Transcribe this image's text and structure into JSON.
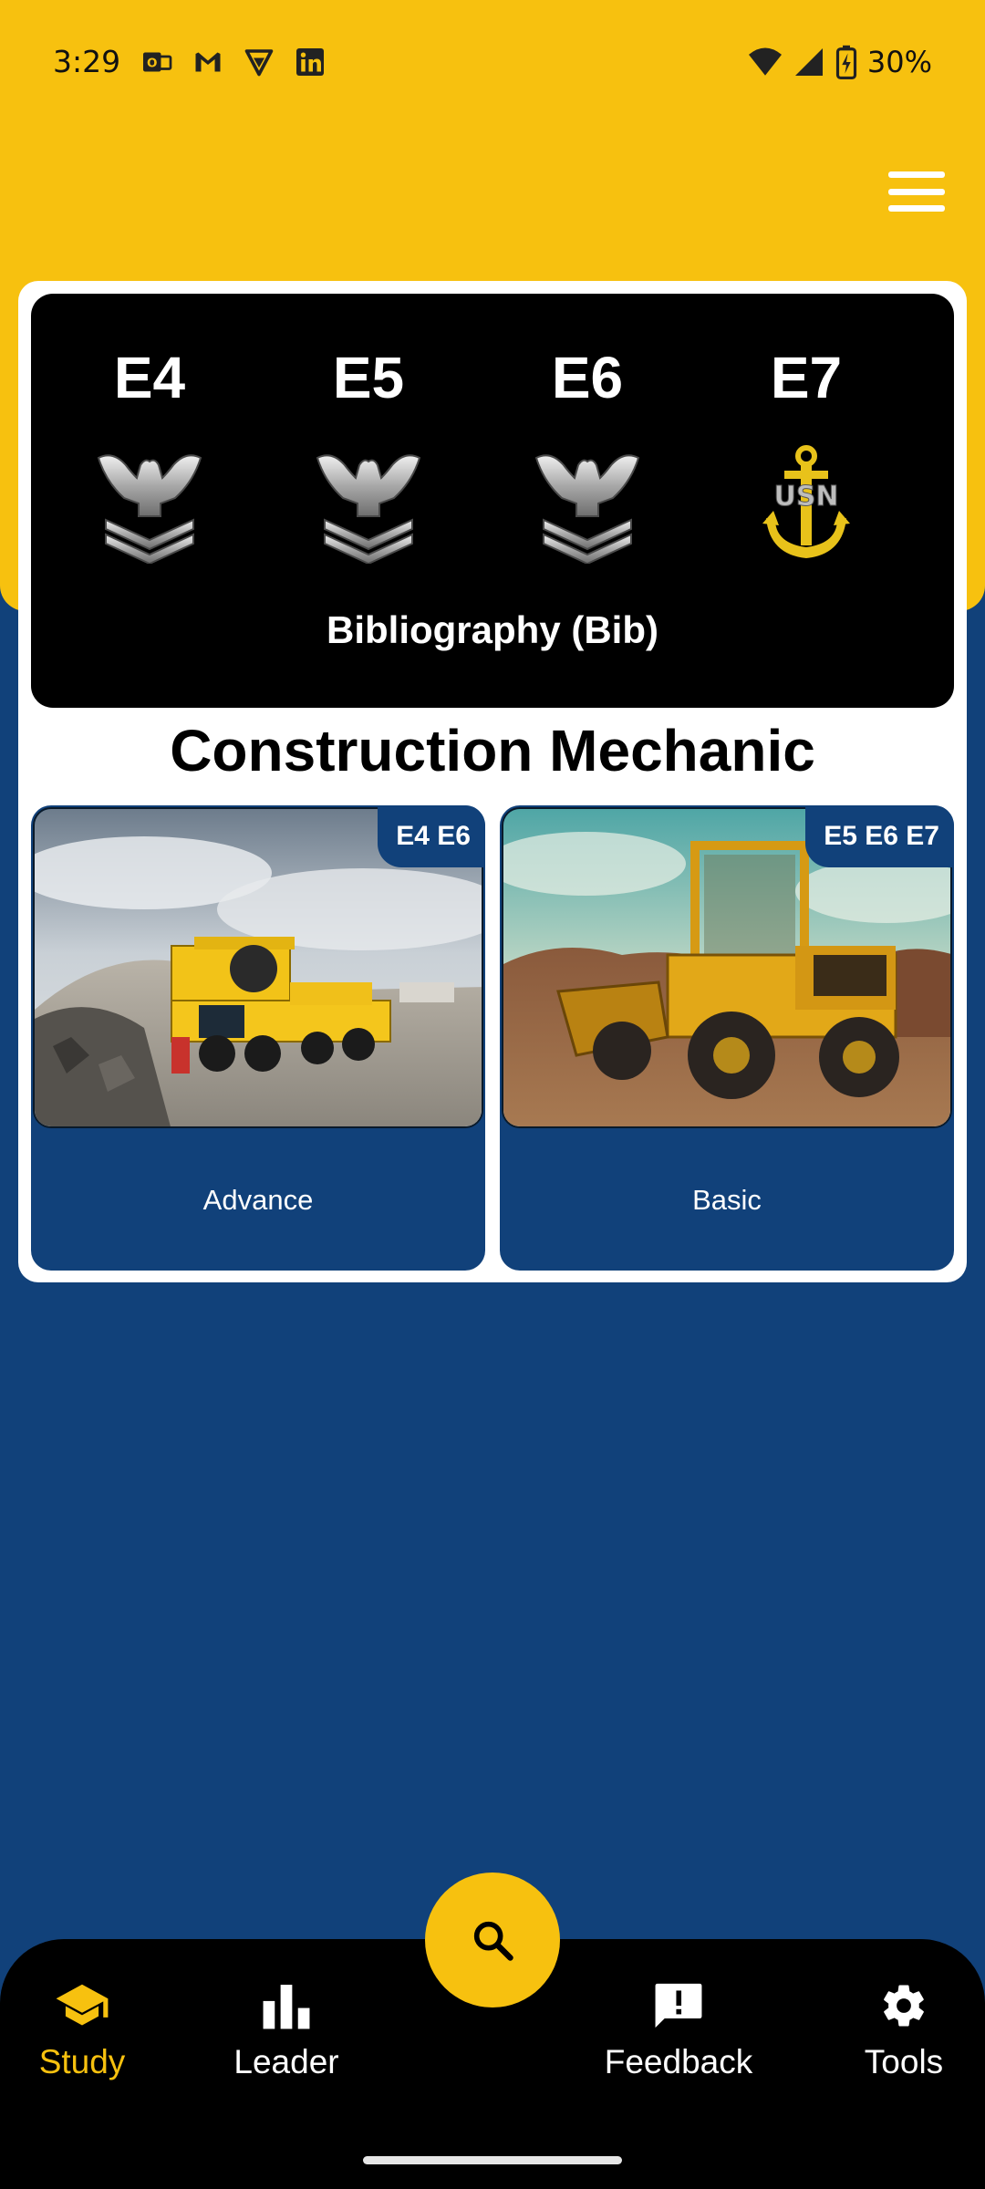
{
  "status_bar": {
    "time": "3:29",
    "battery": "30%",
    "icons": [
      "outlook-icon",
      "gmail-icon",
      "vpn-shield-icon",
      "linkedin-icon",
      "wifi-icon",
      "signal-icon",
      "battery-charging-icon"
    ]
  },
  "header": {
    "menu_icon": "hamburger-menu-icon"
  },
  "rank_panel": {
    "ranks": [
      {
        "label": "E4",
        "badge": "petty-officer-eagle-icon"
      },
      {
        "label": "E5",
        "badge": "petty-officer-eagle-icon"
      },
      {
        "label": "E6",
        "badge": "petty-officer-eagle-icon"
      },
      {
        "label": "E7",
        "badge": "chief-anchor-icon"
      }
    ],
    "anchor_text": "USN",
    "title": "Bibliography (Bib)"
  },
  "section_title": "Construction Mechanic",
  "courses": [
    {
      "label": "Advance",
      "badge": "E4 E6",
      "image": "crane-truck-photo"
    },
    {
      "label": "Basic",
      "badge": "E5 E6 E7",
      "image": "front-loader-photo"
    }
  ],
  "bottom_nav": {
    "items": [
      {
        "label": "Study",
        "icon": "graduation-cap-icon",
        "active": true
      },
      {
        "label": "Leader",
        "icon": "bar-chart-icon",
        "active": false
      },
      {
        "label": "Feedback",
        "icon": "feedback-icon",
        "active": false
      },
      {
        "label": "Tools",
        "icon": "gear-icon",
        "active": false
      }
    ],
    "fab_icon": "search-icon"
  },
  "colors": {
    "accent_yellow": "#f7c10f",
    "navy": "#11417a",
    "black": "#000000"
  }
}
